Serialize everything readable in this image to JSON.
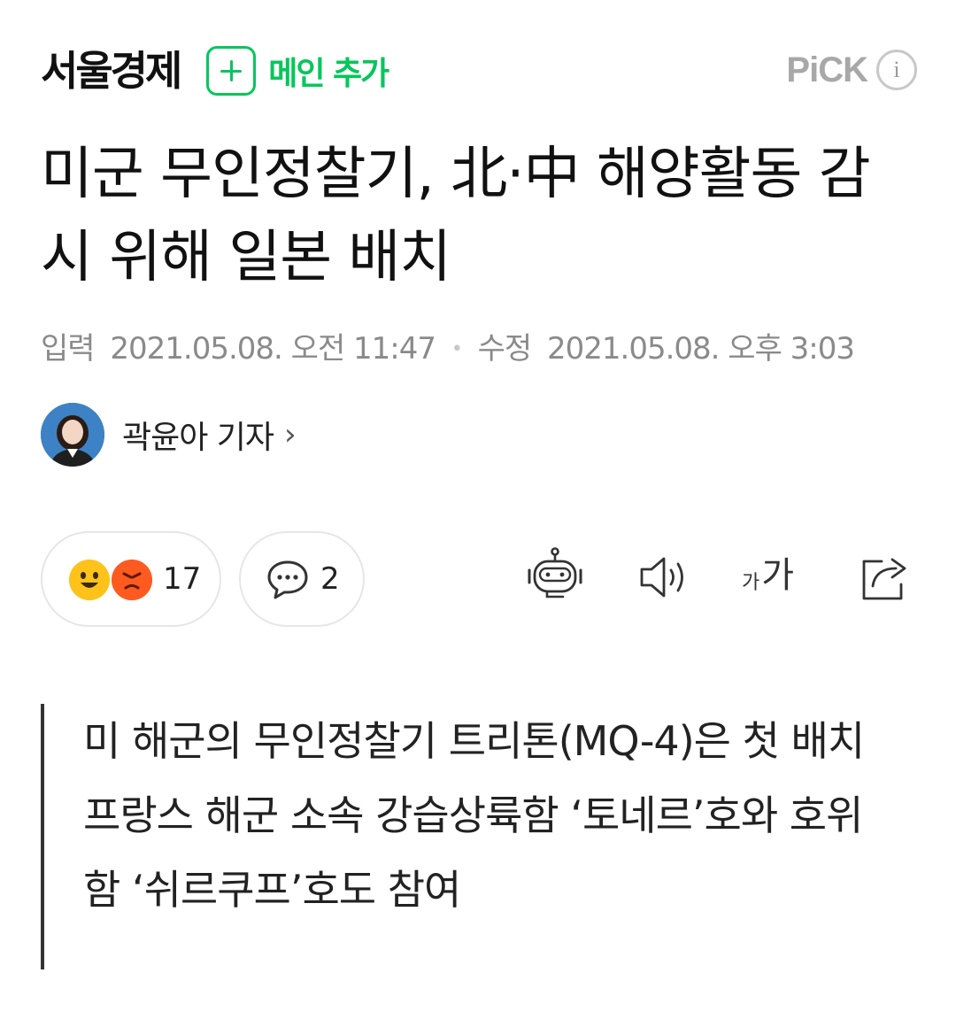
{
  "header": {
    "logo": "서울경제",
    "main_add_label": "메인 추가",
    "pick_label": "PiCK",
    "info_label": "i"
  },
  "article": {
    "headline": "미군 무인정찰기, 北·中 해양활동 감시 위해 일본 배치",
    "input_label": "입력",
    "input_time": "2021.05.08. 오전 11:47",
    "edit_label": "수정",
    "edit_time": "2021.05.08. 오후 3:03",
    "reporter": "곽윤아 기자"
  },
  "actions": {
    "reaction_count": "17",
    "comment_count": "2",
    "font_size_small": "가",
    "font_size_large": "가"
  },
  "summary": [
    "미 해군의 무인정찰기 트리톤(MQ-4)은 첫 배치",
    "프랑스 해군 소속 강습상륙함 ‘토네르’호와 호위함 ‘쉬르쿠프’호도 참여"
  ],
  "colors": {
    "accent_green": "#03c75a",
    "meta_gray": "#8a8a8a",
    "pill_border": "#e6e6e6"
  },
  "icons": [
    "plus-icon",
    "info-icon",
    "chevron-right-icon",
    "smile-emoji-icon",
    "angry-emoji-icon",
    "comment-bubble-icon",
    "robot-summary-icon",
    "speaker-icon",
    "font-size-icon",
    "share-icon"
  ]
}
